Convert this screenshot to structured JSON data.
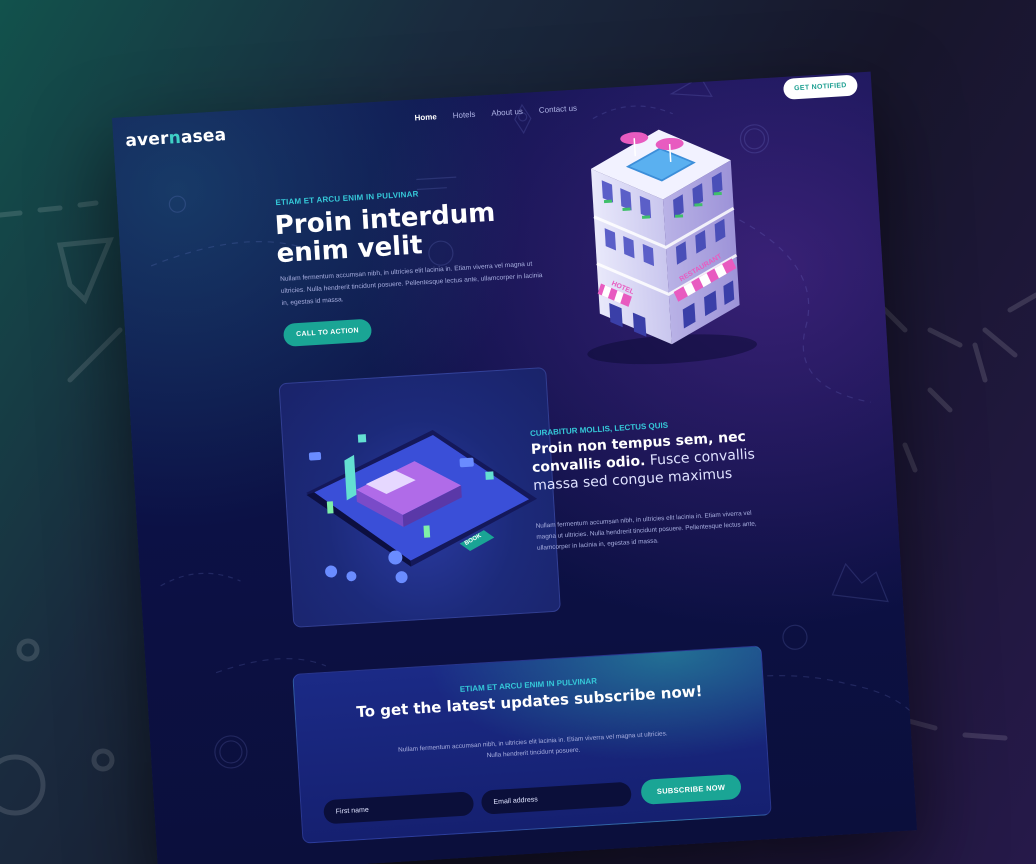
{
  "brand": {
    "logo_pre": "aver",
    "logo_mid": "n",
    "logo_post": "asea",
    "accent": "#3fd0c6"
  },
  "nav": {
    "items": [
      {
        "label": "Home",
        "active": true
      },
      {
        "label": "Hotels"
      },
      {
        "label": "About us"
      },
      {
        "label": "Contact us"
      }
    ],
    "notify_label": "GET NOTIFIED"
  },
  "hero": {
    "kicker": "ETIAM ET ARCU ENIM IN PULVINAR",
    "title": "Proin interdum enim velit",
    "text": "Nullam fermentum accumsan nibh, in ultricies elit lacinia in. Etiam viverra vel magna ut ultricies. Nulla hendrerit tincidunt posuere. Pellentesque lectus ante, ullamcorper in lacinia in, egestas id massa.",
    "cta_label": "CALL TO ACTION",
    "illustration": {
      "sign_hotel": "HOTEL",
      "sign_restaurant": "RESTAURANT"
    }
  },
  "feature": {
    "kicker": "CURABITUR MOLLIS, LECTUS QUIS",
    "title_bold": "Proin non tempus sem, nec convallis odio.",
    "title_light": " Fusce convallis massa sed congue maximus",
    "text": "Nullam fermentum accumsan nibh, in ultricies elit lacinia in. Etiam viverra vel magna ut ultricies. Nulla hendrerit tincidunt posuere. Pellentesque lectus ante, ullamcorper in lacinia in, egestas id massa.",
    "book_label": "BOOK"
  },
  "subscribe": {
    "kicker": "ETIAM ET ARCU ENIM IN PULVINAR",
    "title": "To get the latest updates subscribe now!",
    "text": "Nullam fermentum accumsan nibh, in ultricies elit lacinia in. Etiam viverra vel magna ut ultricies. Nulla hendrerit tincidunt posuere.",
    "first_name_placeholder": "First name",
    "email_placeholder": "Email address",
    "button_label": "SUBSCRIBE NOW"
  },
  "colors": {
    "teal": "#1aa595",
    "cyan": "#35c8d8",
    "navy": "#0f1450",
    "pink": "#e85bc0"
  }
}
